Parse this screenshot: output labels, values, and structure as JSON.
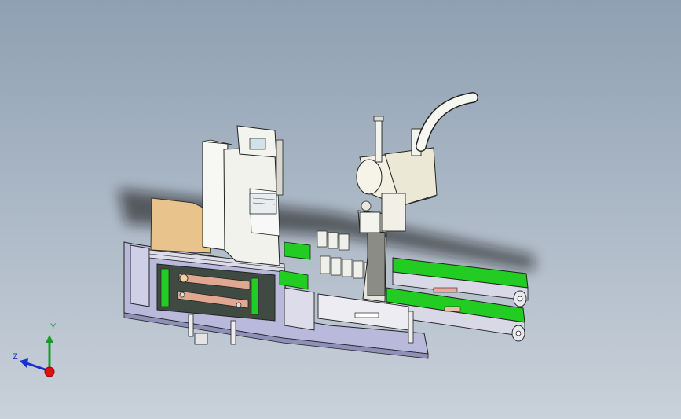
{
  "view": {
    "background_top": "#8fa0b3",
    "background_bottom": "#c9d1da"
  },
  "colors": {
    "frame_plate": "#b9b9dc",
    "wood_plate": "#e8c48c",
    "conveyor_green": "#22cc22",
    "robot_body": "#f2f2ea",
    "copper_rail": "#e0a890",
    "outline": "#222222"
  },
  "triad": {
    "y_label": "Y",
    "z_label": "Z",
    "y_color": "#1a9a2a",
    "z_color": "#1a2fd0",
    "origin_color": "#e01010"
  }
}
